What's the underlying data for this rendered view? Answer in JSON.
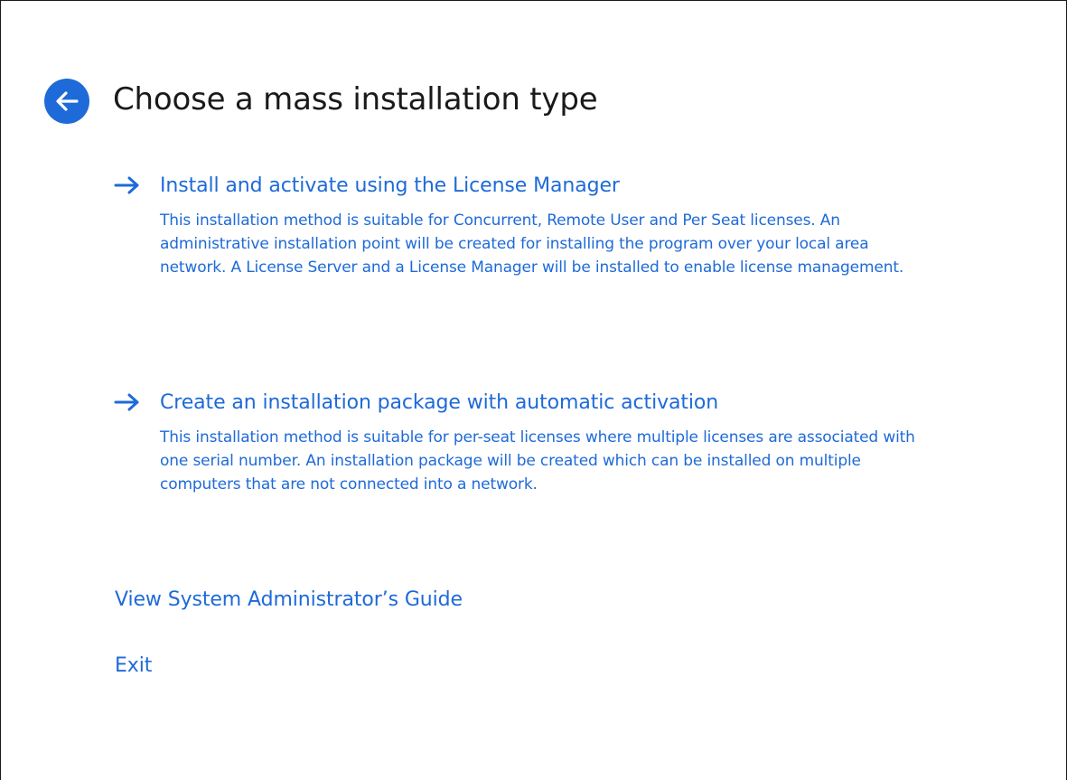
{
  "header": {
    "back_icon": "arrow-left-circle-icon",
    "title": "Choose a mass installation type"
  },
  "options": [
    {
      "icon": "arrow-right-icon",
      "title": "Install and activate using the License Manager",
      "description": "This installation method is suitable for Concurrent, Remote User and Per Seat licenses. An administrative installation point will be created for installing the program over your local area network. A License Server and a License Manager will be installed to enable license management."
    },
    {
      "icon": "arrow-right-icon",
      "title": "Create an installation package with automatic activation",
      "description": "This installation method is suitable for per-seat licenses where multiple licenses are associated with one serial number. An installation package will be created which can be installed on multiple computers that are not connected into a network."
    }
  ],
  "links": {
    "guide": "View System Administrator’s Guide",
    "exit": "Exit"
  },
  "colors": {
    "accent": "#1e6ad8",
    "title_text": "#1a1a1a",
    "background": "#ffffff"
  }
}
